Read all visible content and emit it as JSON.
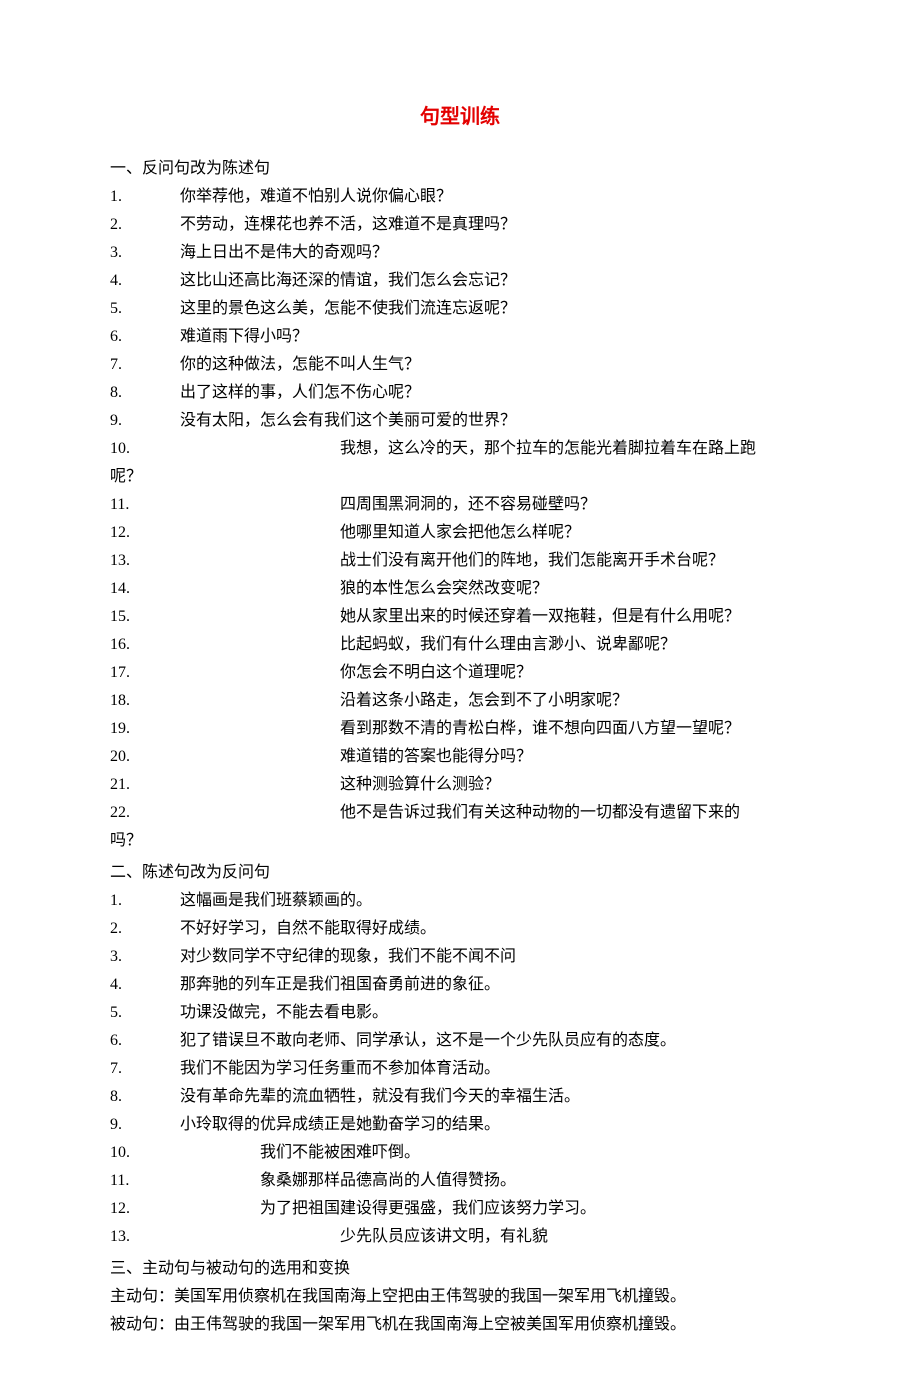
{
  "title": "句型训练",
  "section1_header": "一、反问句改为陈述句",
  "s1_items_a": [
    {
      "n": "1.",
      "t": "你举荐他，难道不怕别人说你偏心眼？"
    },
    {
      "n": "2.",
      "t": "不劳动，连棵花也养不活，这难道不是真理吗？"
    },
    {
      "n": "3.",
      "t": "海上日出不是伟大的奇观吗？"
    },
    {
      "n": "4.",
      "t": "这比山还高比海还深的情谊，我们怎么会忘记？"
    },
    {
      "n": "5.",
      "t": "这里的景色这么美，怎能不使我们流连忘返呢？"
    },
    {
      "n": "6.",
      "t": "难道雨下得小吗？"
    },
    {
      "n": "7.",
      "t": "你的这种做法，怎能不叫人生气？"
    },
    {
      "n": "8.",
      "t": "出了这样的事，人们怎不伤心呢？"
    },
    {
      "n": "9.",
      "t": "没有太阳，怎么会有我们这个美丽可爱的世界？"
    }
  ],
  "s1_item10_num": "10.",
  "s1_item10_text": "我想，这么冷的天，那个拉车的怎能光着脚拉着车在路上跑",
  "s1_item10_tail": "呢？",
  "s1_items_b": [
    {
      "n": "11.",
      "t": "四周围黑洞洞的，还不容易碰壁吗？"
    },
    {
      "n": "12.",
      "t": "他哪里知道人家会把他怎么样呢？"
    },
    {
      "n": "13.",
      "t": "战士们没有离开他们的阵地，我们怎能离开手术台呢？"
    },
    {
      "n": "14.",
      "t": "狼的本性怎么会突然改变呢？"
    },
    {
      "n": "15.",
      "t": "她从家里出来的时候还穿着一双拖鞋，但是有什么用呢？"
    },
    {
      "n": "16.",
      "t": "比起蚂蚁，我们有什么理由言渺小、说卑鄙呢？"
    },
    {
      "n": "17.",
      "t": "你怎会不明白这个道理呢？"
    },
    {
      "n": "18.",
      "t": "沿着这条小路走，怎会到不了小明家呢？"
    },
    {
      "n": "19.",
      "t": "看到那数不清的青松白桦，谁不想向四面八方望一望呢？"
    },
    {
      "n": "20.",
      "t": "难道错的答案也能得分吗？"
    },
    {
      "n": "21.",
      "t": "这种测验算什么测验？"
    }
  ],
  "s1_item22_num": "22.",
  "s1_item22_text": "他不是告诉过我们有关这种动物的一切都没有遗留下来的",
  "s1_item22_tail": "吗？",
  "section2_header": "二、陈述句改为反问句",
  "s2_items_a": [
    {
      "n": "1.",
      "t": "这幅画是我们班蔡颖画的。"
    },
    {
      "n": "2.",
      "t": "不好好学习，自然不能取得好成绩。"
    },
    {
      "n": "3.",
      "t": "对少数同学不守纪律的现象，我们不能不闻不问"
    },
    {
      "n": "4.",
      "t": "那奔驰的列车正是我们祖国奋勇前进的象征。"
    },
    {
      "n": "5.",
      "t": "功课没做完，不能去看电影。"
    },
    {
      "n": "6.",
      "t": "犯了错误旦不敢向老师、同学承认，这不是一个少先队员应有的态度。"
    },
    {
      "n": "7.",
      "t": "我们不能因为学习任务重而不参加体育活动。"
    },
    {
      "n": "8.",
      "t": "没有革命先辈的流血牺牲，就没有我们今天的幸福生活。"
    },
    {
      "n": "9.",
      "t": "小玲取得的优异成绩正是她勤奋学习的结果。"
    }
  ],
  "s2_items_b": [
    {
      "n": "10.",
      "t": "我们不能被困难吓倒。"
    },
    {
      "n": "11.",
      "t": "象桑娜那样品德高尚的人值得赞扬。"
    },
    {
      "n": "12.",
      "t": "为了把祖国建设得更强盛，我们应该努力学习。"
    }
  ],
  "s2_item13_num": "13.",
  "s2_item13_text": "少先队员应该讲文明，有礼貌",
  "section3_header": "三、主动句与被动句的选用和变换",
  "s3_active": "主动句：美国军用侦察机在我国南海上空把由王伟驾驶的我国一架军用飞机撞毁。",
  "s3_passive": "被动句：由王伟驾驶的我国一架军用飞机在我国南海上空被美国军用侦察机撞毁。"
}
